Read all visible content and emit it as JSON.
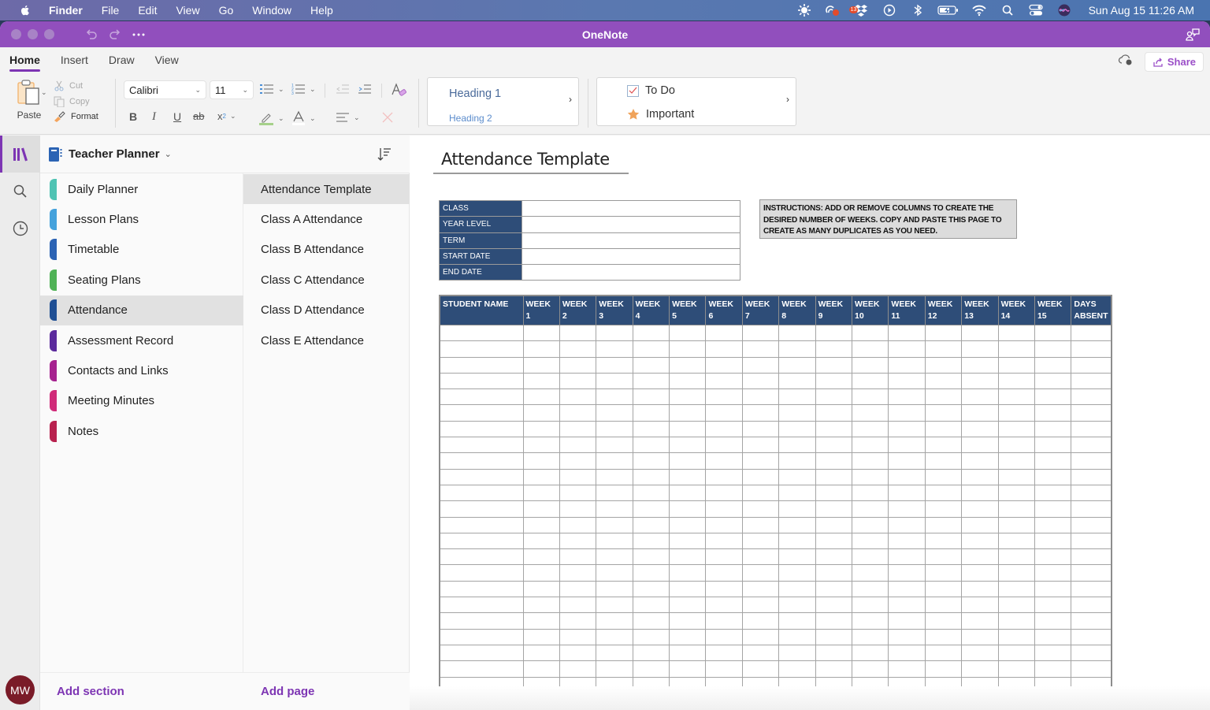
{
  "menubar": {
    "app_name": "Finder",
    "items": [
      "File",
      "Edit",
      "View",
      "Go",
      "Window",
      "Help"
    ],
    "status_icons": [
      "sun-icon",
      "creative-cloud-icon",
      "dropbox-icon",
      "play-icon",
      "bluetooth-icon",
      "battery-icon",
      "wifi-icon",
      "spotlight-icon",
      "control-center-icon",
      "siri-icon"
    ],
    "dropbox_badge": "13",
    "clock": "Sun Aug 15  11:26 AM"
  },
  "window": {
    "title": "OneNote"
  },
  "ribbon": {
    "tabs": [
      "Home",
      "Insert",
      "Draw",
      "View"
    ],
    "active_tab": "Home",
    "paste_label": "Paste",
    "cut_label": "Cut",
    "copy_label": "Copy",
    "format_label": "Format",
    "font_name": "Calibri",
    "font_size": "11",
    "styles": {
      "heading1": "Heading 1",
      "heading2": "Heading 2"
    },
    "tags": {
      "todo": "To Do",
      "important": "Important"
    },
    "share_label": "Share",
    "colors": {
      "accent": "#7d35b3",
      "titlebar": "#914fbd",
      "highlight": "#a6d18a"
    }
  },
  "notebook": {
    "name": "Teacher Planner",
    "sections": [
      {
        "label": "Daily Planner",
        "color": "#4fc3b3"
      },
      {
        "label": "Lesson Plans",
        "color": "#45a2dc"
      },
      {
        "label": "Timetable",
        "color": "#2b63b4"
      },
      {
        "label": "Seating Plans",
        "color": "#4fb256"
      },
      {
        "label": "Attendance",
        "color": "#1f4f94",
        "active": true
      },
      {
        "label": "Assessment Record",
        "color": "#5b2a9c"
      },
      {
        "label": "Contacts and Links",
        "color": "#a6228f"
      },
      {
        "label": "Meeting Minutes",
        "color": "#d02b79"
      },
      {
        "label": "Notes",
        "color": "#b8214e"
      }
    ],
    "pages": [
      {
        "label": "Attendance Template",
        "active": true
      },
      {
        "label": "Class A Attendance"
      },
      {
        "label": "Class B Attendance"
      },
      {
        "label": "Class C Attendance"
      },
      {
        "label": "Class D Attendance"
      },
      {
        "label": "Class E Attendance"
      }
    ],
    "add_section_label": "Add section",
    "add_page_label": "Add page",
    "user_initials": "MW"
  },
  "page": {
    "title": "Attendance Template",
    "info_fields": [
      {
        "label": "CLASS",
        "value": ""
      },
      {
        "label": "YEAR LEVEL",
        "value": ""
      },
      {
        "label": "TERM",
        "value": ""
      },
      {
        "label": "START DATE",
        "value": ""
      },
      {
        "label": "END DATE",
        "value": ""
      }
    ],
    "instructions": "INSTRUCTIONS: ADD OR REMOVE COLUMNS TO CREATE THE DESIRED NUMBER OF WEEKS. COPY AND PASTE THIS PAGE TO CREATE AS MANY DUPLICATES AS YOU NEED.",
    "attendance_table": {
      "headers": [
        [
          "STUDENT NAME"
        ],
        [
          "WEEK",
          "1"
        ],
        [
          "WEEK",
          "2"
        ],
        [
          "WEEK",
          "3"
        ],
        [
          "WEEK",
          "4"
        ],
        [
          "WEEK",
          "5"
        ],
        [
          "WEEK",
          "6"
        ],
        [
          "WEEK",
          "7"
        ],
        [
          "WEEK",
          "8"
        ],
        [
          "WEEK",
          "9"
        ],
        [
          "WEEK",
          "10"
        ],
        [
          "WEEK",
          "11"
        ],
        [
          "WEEK",
          "12"
        ],
        [
          "WEEK",
          "13"
        ],
        [
          "WEEK",
          "14"
        ],
        [
          "WEEK",
          "15"
        ],
        [
          "DAYS",
          "ABSENT"
        ]
      ],
      "empty_row_count": 23
    }
  }
}
